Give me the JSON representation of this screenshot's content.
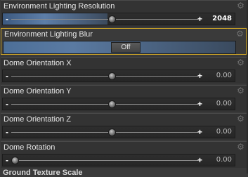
{
  "properties": [
    {
      "label": "Environment Lighting Resolution",
      "value": "2048",
      "position": 0.45,
      "fill": 0.45
    },
    {
      "label": "Environment Lighting Blur",
      "toggle": "Off"
    },
    {
      "label": "Dome Orientation X",
      "value": "0.00",
      "position": 0.5
    },
    {
      "label": "Dome Orientation Y",
      "value": "0.00",
      "position": 0.5
    },
    {
      "label": "Dome Orientation Z",
      "value": "0.00",
      "position": 0.5
    },
    {
      "label": "Dome Rotation",
      "value": "0.00",
      "position": 0.0
    }
  ],
  "cutoff_label": "Ground Texture Scale"
}
